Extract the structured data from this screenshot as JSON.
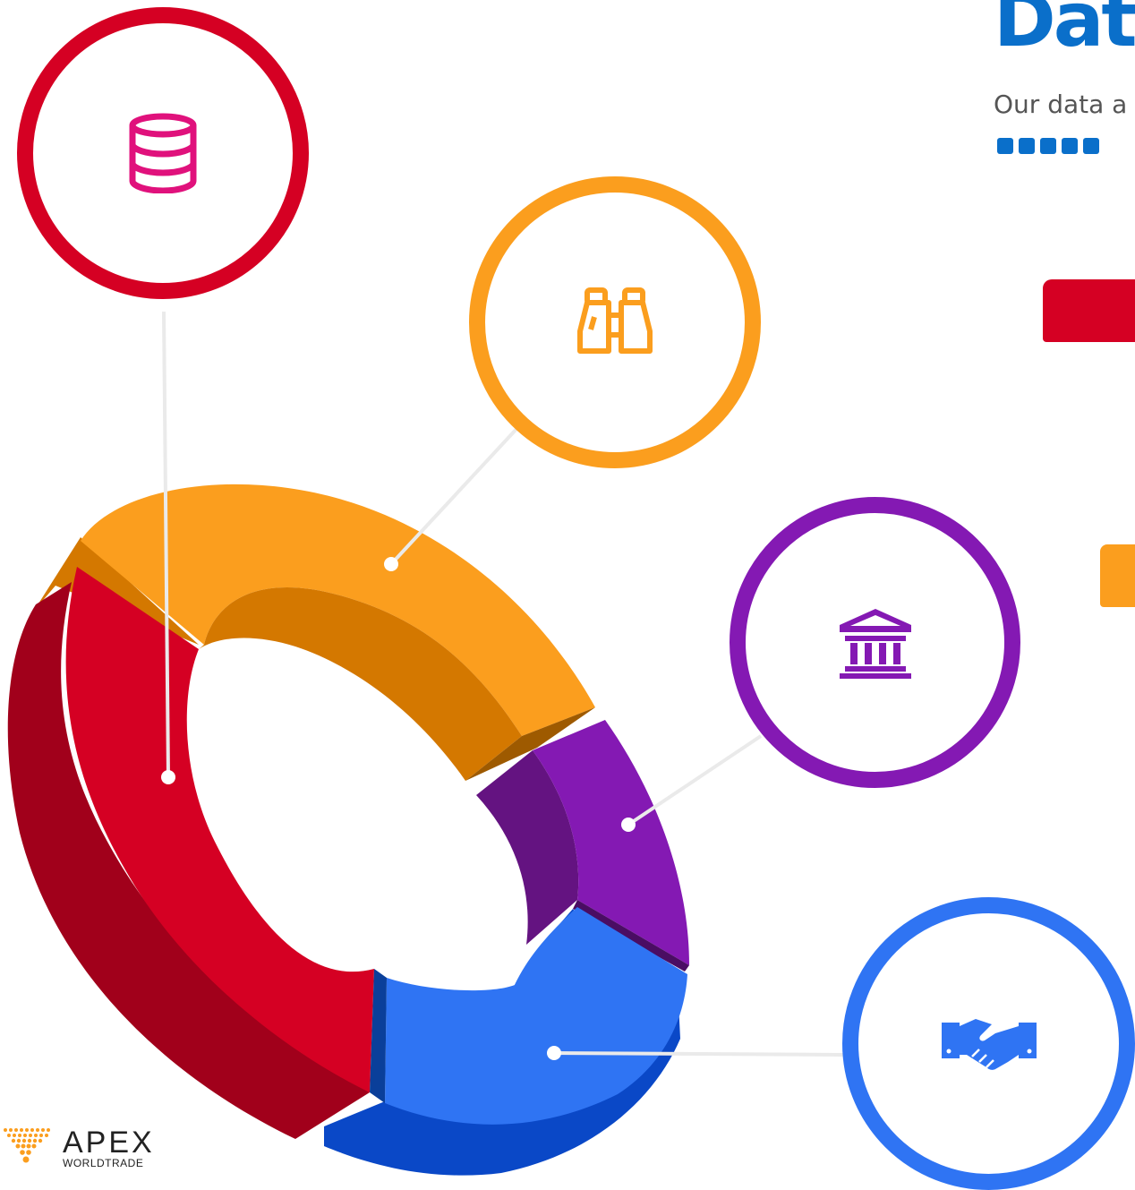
{
  "header": {
    "title": "Dat",
    "subtitle": "Our data a"
  },
  "colors": {
    "brand_blue": "#0a6fca",
    "red": "#d50023",
    "red_dark": "#a1001b",
    "orange": "#fb9e1e",
    "orange_dark": "#d47800",
    "purple": "#8419b3",
    "purple_dark": "#641381",
    "blue": "#2f74f3",
    "blue_dark": "#0a48c7",
    "pink_icon": "#e0117c",
    "connector": "#eaeaea"
  },
  "segments": [
    {
      "name": "red",
      "color": "#d50023",
      "side_color": "#a1001b",
      "icon": "database-icon",
      "ring": "#d50023",
      "icon_color": "#e0117c"
    },
    {
      "name": "orange",
      "color": "#fb9e1e",
      "side_color": "#d47800",
      "icon": "binoculars-icon",
      "ring": "#fb9e1e",
      "icon_color": "#fb9e1e"
    },
    {
      "name": "purple",
      "color": "#8419b3",
      "side_color": "#641381",
      "icon": "bank-icon",
      "ring": "#8419b3",
      "icon_color": "#8419b3"
    },
    {
      "name": "blue",
      "color": "#2f74f3",
      "side_color": "#0a48c7",
      "icon": "handshake-icon",
      "ring": "#2f74f3",
      "icon_color": "#2f74f3"
    }
  ],
  "logo": {
    "word": "APEX",
    "sub": "WORLDTRADE"
  }
}
